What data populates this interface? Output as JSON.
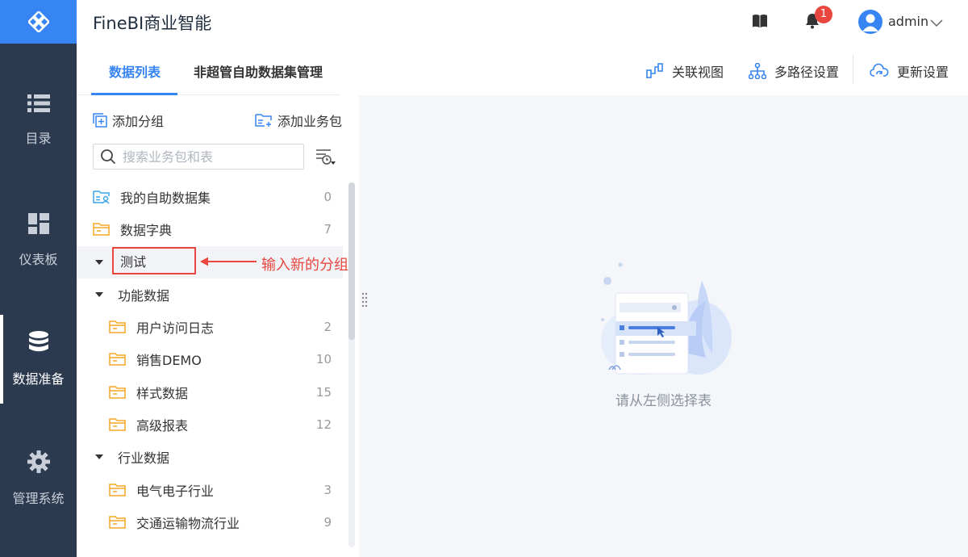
{
  "header": {
    "title": "FineBI商业智能",
    "notification_count": "1",
    "username": "admin"
  },
  "nav": {
    "items": [
      {
        "label": "目录",
        "icon": "list-icon"
      },
      {
        "label": "仪表板",
        "icon": "dashboard-icon"
      },
      {
        "label": "数据准备",
        "icon": "database-icon",
        "active": true
      },
      {
        "label": "管理系统",
        "icon": "gear-icon"
      }
    ]
  },
  "tabs": [
    {
      "label": "数据列表",
      "active": true
    },
    {
      "label": "非超管自助数据集管理",
      "active": false
    }
  ],
  "toolbar": {
    "relation_view": "关联视图",
    "multipath": "多路径设置",
    "update_settings": "更新设置"
  },
  "panel": {
    "add_group": "添加分组",
    "add_package": "添加业务包",
    "search_placeholder": "搜索业务包和表"
  },
  "tree": [
    {
      "label": "我的自助数据集",
      "count": "0",
      "level": 0,
      "icon": "self-dataset-folder-icon"
    },
    {
      "label": "数据字典",
      "count": "7",
      "level": 0,
      "icon": "folder-icon"
    },
    {
      "label": "测试",
      "count": "",
      "level": 0,
      "group": true,
      "editing": true
    },
    {
      "label": "功能数据",
      "count": "",
      "level": 0,
      "group": true
    },
    {
      "label": "用户访问日志",
      "count": "2",
      "level": 1,
      "icon": "folder-icon"
    },
    {
      "label": "销售DEMO",
      "count": "10",
      "level": 1,
      "icon": "folder-icon"
    },
    {
      "label": "样式数据",
      "count": "15",
      "level": 1,
      "icon": "folder-icon"
    },
    {
      "label": "高级报表",
      "count": "12",
      "level": 1,
      "icon": "folder-icon"
    },
    {
      "label": "行业数据",
      "count": "",
      "level": 0,
      "group": true
    },
    {
      "label": "电气电子行业",
      "count": "3",
      "level": 1,
      "icon": "folder-icon"
    },
    {
      "label": "交通运输物流行业",
      "count": "9",
      "level": 1,
      "icon": "folder-icon"
    }
  ],
  "annotation": "输入新的分组",
  "empty_state": "请从左侧选择表",
  "colors": {
    "accent": "#3685f2",
    "nav_bg": "#2c3a4f",
    "annotation": "#e8463f",
    "folder": "#f5a623"
  }
}
